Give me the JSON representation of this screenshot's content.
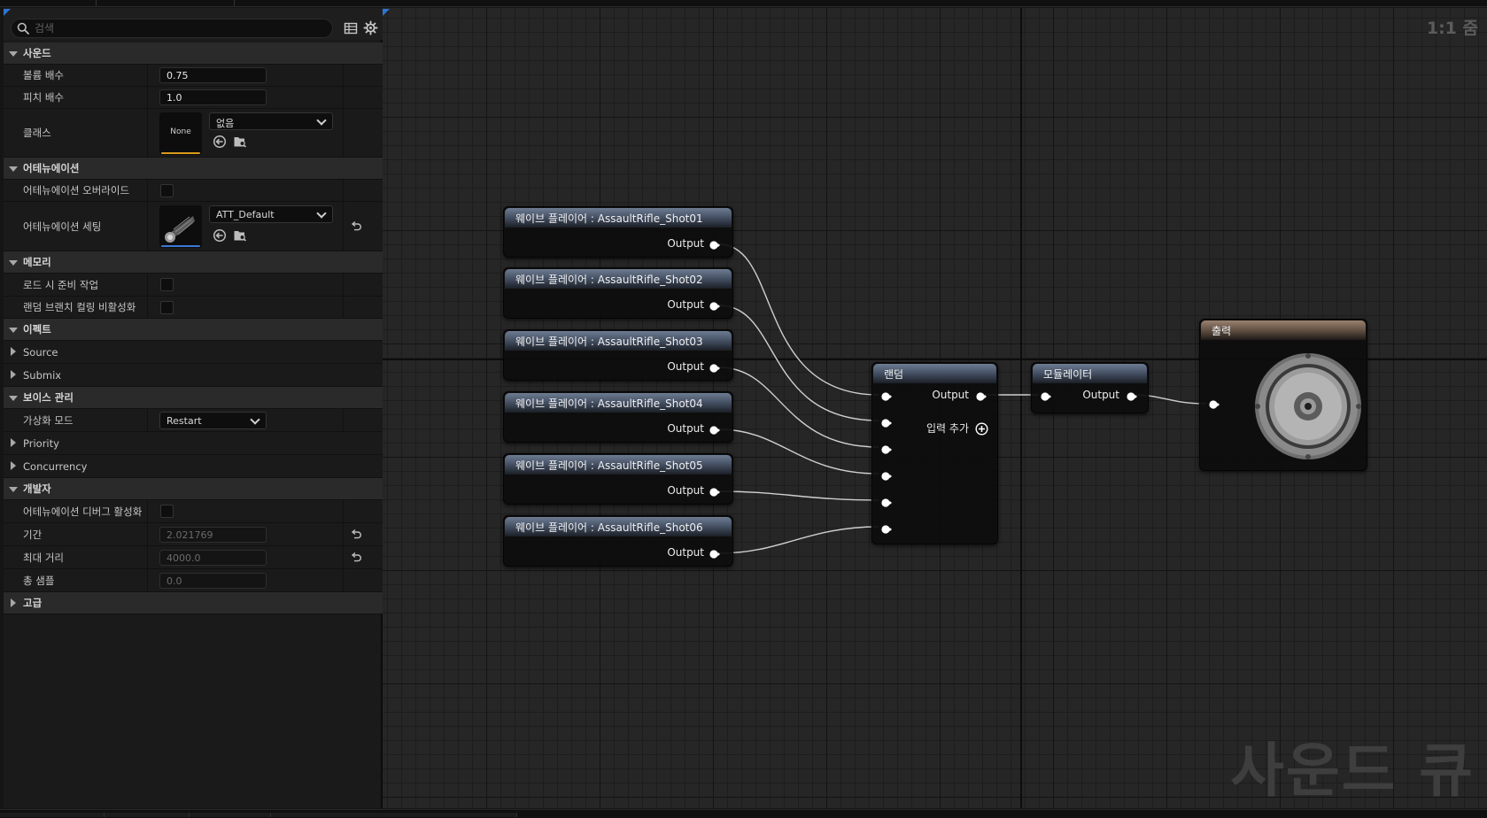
{
  "search": {
    "placeholder": "검색"
  },
  "categories": {
    "sound": "사운드",
    "attenuation": "어테뉴에이션",
    "memory": "메모리",
    "effect": "이펙트",
    "voice": "보이스 관리",
    "developer": "개발자",
    "advanced": "고급"
  },
  "sound": {
    "volume": {
      "label": "볼륨 배수",
      "value": "0.75"
    },
    "pitch": {
      "label": "피치 배수",
      "value": "1.0"
    },
    "class": {
      "label": "클래스",
      "thumb": "None",
      "combo": "없음"
    }
  },
  "attenuation": {
    "override": {
      "label": "어테뉴에이션 오버라이드"
    },
    "settings": {
      "label": "어테뉴에이션 세팅",
      "combo": "ATT_Default"
    }
  },
  "memory": {
    "preload": {
      "label": "로드 시 준비 작업"
    },
    "culling": {
      "label": "랜덤 브랜치 컬링 비활성화"
    }
  },
  "effect": {
    "source": "Source",
    "submix": "Submix"
  },
  "voice": {
    "virtualization": {
      "label": "가상화 모드",
      "value": "Restart"
    },
    "priority": "Priority",
    "concurrency": "Concurrency"
  },
  "developer": {
    "debug": {
      "label": "어테뉴에이션 디버그 활성화"
    },
    "duration": {
      "label": "기간",
      "value": "2.021769"
    },
    "max_distance": {
      "label": "최대 거리",
      "value": "4000.0"
    },
    "total_samples": {
      "label": "총 샘플",
      "value": "0.0"
    }
  },
  "graph": {
    "zoom": "1:1 줌",
    "watermark": "사운드 큐",
    "wave_nodes": [
      {
        "title": "웨이브 플레이어 : AssaultRifle_Shot01",
        "output": "Output"
      },
      {
        "title": "웨이브 플레이어 : AssaultRifle_Shot02",
        "output": "Output"
      },
      {
        "title": "웨이브 플레이어 : AssaultRifle_Shot03",
        "output": "Output"
      },
      {
        "title": "웨이브 플레이어 : AssaultRifle_Shot04",
        "output": "Output"
      },
      {
        "title": "웨이브 플레이어 : AssaultRifle_Shot05",
        "output": "Output"
      },
      {
        "title": "웨이브 플레이어 : AssaultRifle_Shot06",
        "output": "Output"
      }
    ],
    "random_node": {
      "title": "랜덤",
      "output": "Output",
      "add_input": "입력 추가"
    },
    "modulator_node": {
      "title": "모듈레이터",
      "output": "Output"
    },
    "output_node": {
      "title": "출력"
    }
  },
  "colors": {
    "thumb_bar_class": "#d99a1c",
    "thumb_bar_att": "#3c78d8",
    "wire": "#cfcfcf",
    "corner_accent": "#2f74d0"
  }
}
